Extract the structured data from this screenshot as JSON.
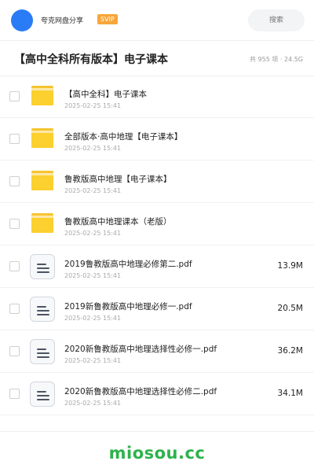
{
  "header": {
    "brand": "夸克网盘分享",
    "badge": "SVIP",
    "search_placeholder": "搜索"
  },
  "share": {
    "title": "【高中全科所有版本】电子课本",
    "summary": "共 955 项 · 24.5G"
  },
  "files": [
    {
      "type": "folder",
      "name": "【高中全科】电子课本",
      "date": "2025-02-25 15:41",
      "size": ""
    },
    {
      "type": "folder",
      "name": "全部版本·高中地理【电子课本】",
      "date": "2025-02-25 15:41",
      "size": ""
    },
    {
      "type": "folder",
      "name": "鲁教版高中地理【电子课本】",
      "date": "2025-02-25 15:41",
      "size": ""
    },
    {
      "type": "folder",
      "name": "鲁教版高中地理课本（老版）",
      "date": "2025-02-25 15:41",
      "size": ""
    },
    {
      "type": "file",
      "name": "2019鲁教版高中地理必修第二.pdf",
      "date": "2025-02-25 15:41",
      "size": "13.9M"
    },
    {
      "type": "file",
      "name": "2019新鲁教版高中地理必修一.pdf",
      "date": "2025-02-25 15:41",
      "size": "20.5M"
    },
    {
      "type": "file",
      "name": "2020新鲁教版高中地理选择性必修一.pdf",
      "date": "2025-02-25 15:41",
      "size": "36.2M"
    },
    {
      "type": "file",
      "name": "2020新鲁教版高中地理选择性必修二.pdf",
      "date": "2025-02-25 15:41",
      "size": "34.1M"
    }
  ],
  "watermark": "miosou.cc",
  "colors": {
    "accent_blue": "#2a7cf6",
    "svip_orange": "#f7a63a",
    "folder_yellow": "#fbd02f",
    "watermark_green": "#2db24c"
  }
}
